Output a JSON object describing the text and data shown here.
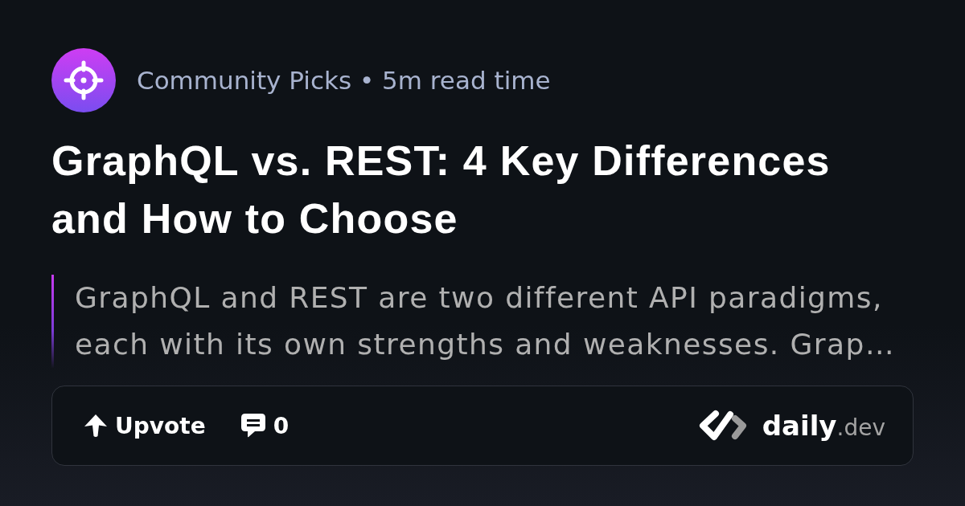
{
  "source": {
    "meta": "Community Picks • 5m read time"
  },
  "title": "GraphQL vs. REST: 4 Key Differences and How to Choose",
  "summary": "GraphQL and REST are two different API paradigms, each with its own strengths and weaknesses. Grap…",
  "actions": [
    {
      "kind": "upvote",
      "label": "Upvote"
    },
    {
      "kind": "comments",
      "label": "0"
    }
  ],
  "brand": {
    "name": "daily",
    "suffix": ".dev"
  }
}
